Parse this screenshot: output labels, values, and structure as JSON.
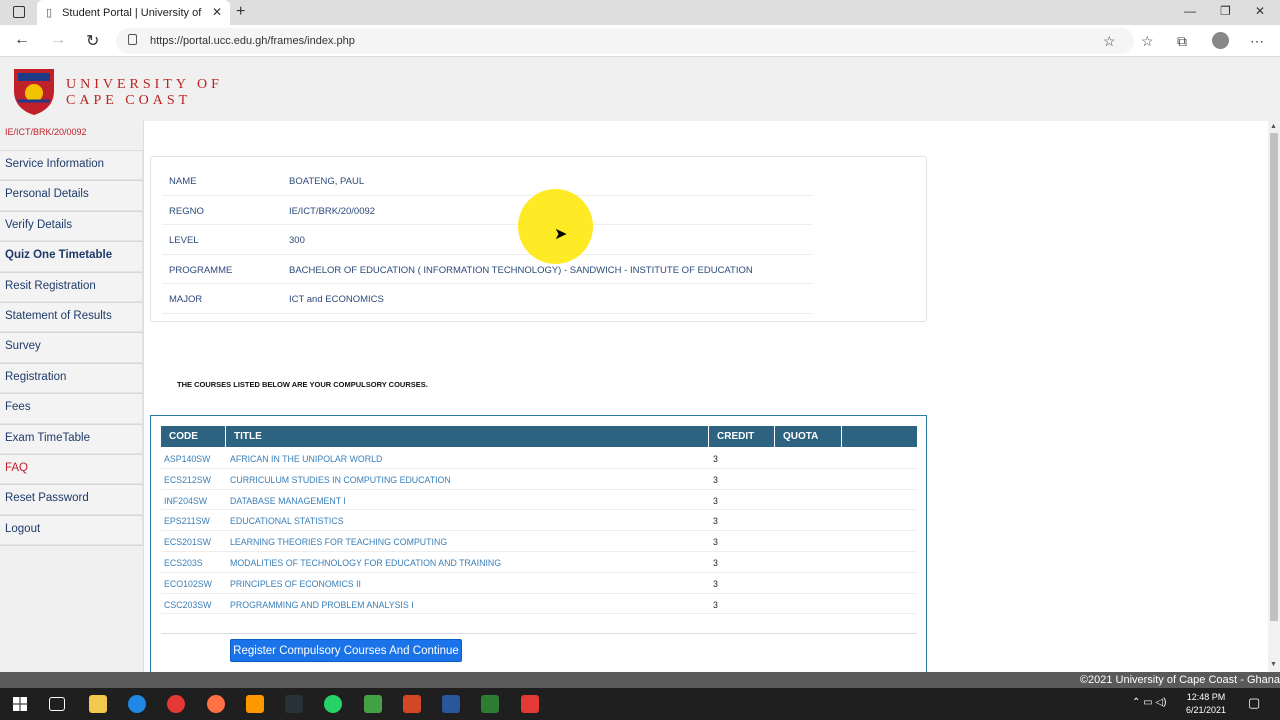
{
  "browser": {
    "tab_title": "Student Portal | University of Cape Coast",
    "url": "https://portal.ucc.edu.gh/frames/index.php"
  },
  "header": {
    "logo_line1": "UNIVERSITY OF",
    "logo_line2": "CAPE COAST"
  },
  "sidebar": {
    "regno": "IE/ICT/BRK/20/0092",
    "items": [
      {
        "label": "Service Information"
      },
      {
        "label": "Personal Details"
      },
      {
        "label": "Verify Details"
      },
      {
        "label": "Quiz One Timetable"
      },
      {
        "label": "Resit Registration"
      },
      {
        "label": "Statement of Results"
      },
      {
        "label": "Survey"
      },
      {
        "label": "Registration"
      },
      {
        "label": "Fees"
      },
      {
        "label": "Exam TimeTable"
      },
      {
        "label": "FAQ"
      },
      {
        "label": "Reset Password"
      },
      {
        "label": "Logout"
      }
    ]
  },
  "student": {
    "rows": [
      {
        "key": "NAME",
        "value": "BOATENG, PAUL"
      },
      {
        "key": "REGNO",
        "value": "IE/ICT/BRK/20/0092"
      },
      {
        "key": "LEVEL",
        "value": "300"
      },
      {
        "key": "PROGRAMME",
        "value": "BACHELOR OF EDUCATION ( INFORMATION TECHNOLOGY) - SANDWICH - INSTITUTE OF EDUCATION"
      },
      {
        "key": "MAJOR",
        "value": "ICT and ECONOMICS"
      }
    ]
  },
  "courses": {
    "notice": "THE COURSES LISTED BELOW ARE YOUR COMPULSORY COURSES.",
    "headers": {
      "code": "CODE",
      "title": "TITLE",
      "credit": "CREDIT",
      "quota": "QUOTA"
    },
    "rows": [
      {
        "code": "ASP140SW",
        "title": "AFRICAN IN THE UNIPOLAR WORLD",
        "credit": "3"
      },
      {
        "code": "ECS212SW",
        "title": "CURRICULUM STUDIES IN COMPUTING EDUCATION",
        "credit": "3"
      },
      {
        "code": "INF204SW",
        "title": "DATABASE MANAGEMENT I",
        "credit": "3"
      },
      {
        "code": "EPS211SW",
        "title": "EDUCATIONAL STATISTICS",
        "credit": "3"
      },
      {
        "code": "ECS201SW",
        "title": "LEARNING THEORIES FOR TEACHING COMPUTING",
        "credit": "3"
      },
      {
        "code": "ECS203S",
        "title": "MODALITIES OF TECHNOLOGY FOR EDUCATION AND TRAINING",
        "credit": "3"
      },
      {
        "code": "ECO102SW",
        "title": "PRINCIPLES OF ECONOMICS II",
        "credit": "3"
      },
      {
        "code": "CSC203SW",
        "title": "PROGRAMMING AND PROBLEM ANALYSIS I",
        "credit": "3"
      }
    ],
    "register_button": "Register Compulsory Courses And Continue"
  },
  "footer": {
    "text": "©2021 University of Cape Coast - Ghana"
  },
  "taskbar": {
    "time": "12:48 PM",
    "date": "6/21/2021"
  },
  "colors": {
    "header_bg": "#2d6380",
    "brand_red": "#c0202a",
    "link_blue": "#3a7fb8",
    "button_blue": "#1a73e8"
  }
}
